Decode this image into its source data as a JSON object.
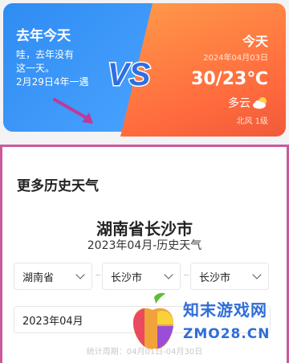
{
  "compare": {
    "last_year": {
      "title": "去年今天",
      "message_lines": [
        "哇，去年没有",
        "这一天。",
        "2月29日4年一遇"
      ]
    },
    "vs_label": "VS",
    "today": {
      "title": "今天",
      "date": "2024年04月03日",
      "temperature": "30/23℃",
      "condition": "多云",
      "condition_icon": "partly-cloudy-icon",
      "wind": "北风 1级"
    },
    "colors": {
      "left": "#2f8cf2",
      "right": "#ff6a3d",
      "highlight_border": "#c85a9c"
    }
  },
  "history": {
    "title": "更多历史天气",
    "city_title": "湖南省长沙市",
    "subtitle": "2023年04月-历史天气",
    "province_select": "湖南省",
    "city_select": "长沙市",
    "district_select": "长沙市",
    "month_select": "2023年04月",
    "stat_text": "统计周期：04月01日-04月30日"
  },
  "watermark": {
    "line1": "知末游戏网",
    "line2": "ZMO28.CN"
  }
}
